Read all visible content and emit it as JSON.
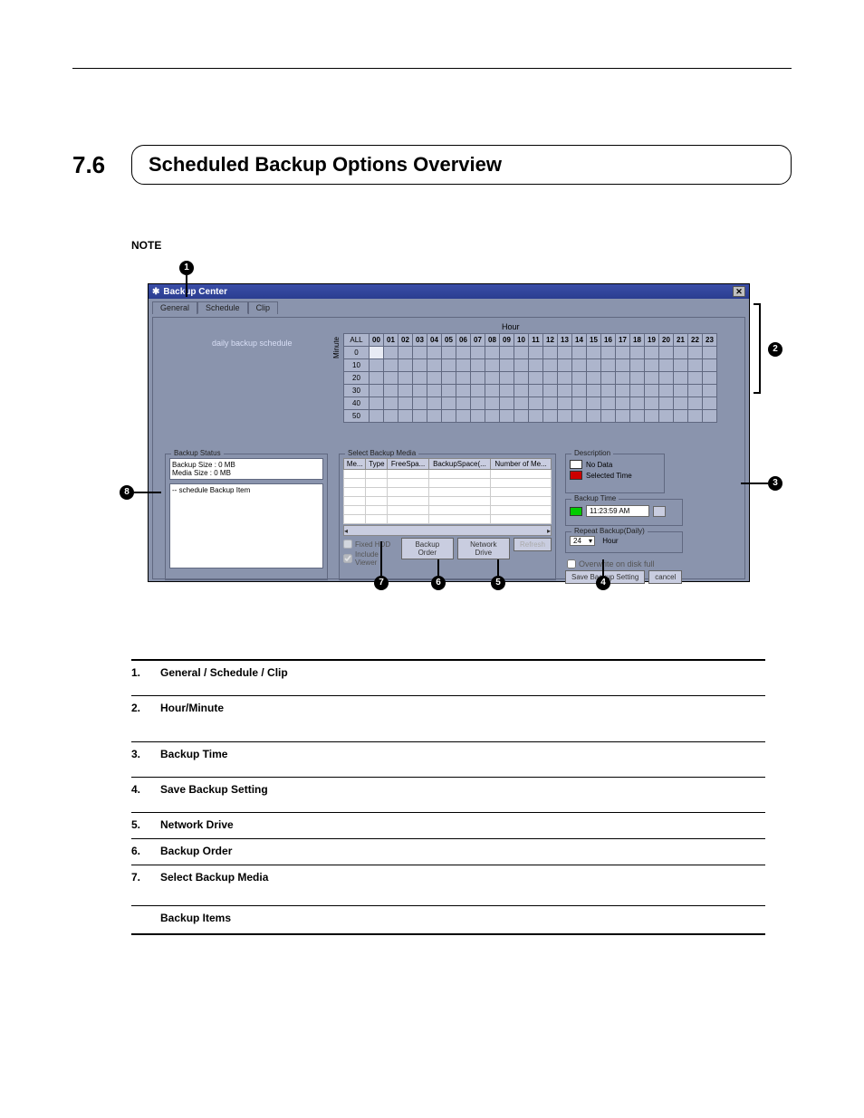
{
  "section": {
    "number": "7.6",
    "title": "Scheduled Backup Options Overview"
  },
  "note_label": "NOTE",
  "window": {
    "title": "Backup Center",
    "close": "✕",
    "tabs": {
      "general": "General",
      "schedule": "Schedule",
      "clip": "Clip"
    },
    "sched_label": "daily backup schedule",
    "hour_label": "Hour",
    "minute_label": "Minute",
    "all_label": "ALL",
    "hours": [
      "00",
      "01",
      "02",
      "03",
      "04",
      "05",
      "06",
      "07",
      "08",
      "09",
      "10",
      "11",
      "12",
      "13",
      "14",
      "15",
      "16",
      "17",
      "18",
      "19",
      "20",
      "21",
      "22",
      "23"
    ],
    "minutes": [
      "0",
      "10",
      "20",
      "30",
      "40",
      "50"
    ],
    "backup_status": {
      "title": "Backup Status",
      "line1": "Backup Size : 0 MB",
      "line2": "Media Size : 0 MB",
      "tree_item": "schedule Backup Item"
    },
    "media": {
      "title": "Select Backup Media",
      "cols": {
        "me": "Me...",
        "type": "Type",
        "free": "FreeSpa...",
        "space": "BackupSpace(...",
        "num": "Number of Me..."
      },
      "chk_fixed": "Fixed HDD",
      "chk_viewer": "Include Viewer",
      "btn_order": "Backup Order",
      "btn_network": "Network Drive",
      "btn_refresh": "Refresh"
    },
    "desc": {
      "title": "Description",
      "nodata": "No Data",
      "selected": "Selected Time"
    },
    "backup_time": {
      "title": "Backup Time",
      "value": "11:23:59 AM"
    },
    "repeat": {
      "title": "Repeat Backup(Daily)",
      "value": "24",
      "unit": "Hour"
    },
    "overwrite": "Overwrite on disk full",
    "btn_save": "Save Backup Setting",
    "btn_cancel": "cancel"
  },
  "callouts": {
    "c1": "1",
    "c2": "2",
    "c3": "3",
    "c4": "4",
    "c5": "5",
    "c6": "6",
    "c7": "7",
    "c8": "8"
  },
  "glossary": [
    {
      "n": "1.",
      "t": "General / Schedule / Clip"
    },
    {
      "n": "2.",
      "t": "Hour/Minute"
    },
    {
      "n": "3.",
      "t": "Backup Time"
    },
    {
      "n": "4.",
      "t": "Save Backup Setting"
    },
    {
      "n": "5.",
      "t": "Network Drive"
    },
    {
      "n": "6.",
      "t": "Backup Order"
    },
    {
      "n": "7.",
      "t": "Select Backup Media"
    },
    {
      "n": "",
      "t": "Backup Items"
    }
  ]
}
